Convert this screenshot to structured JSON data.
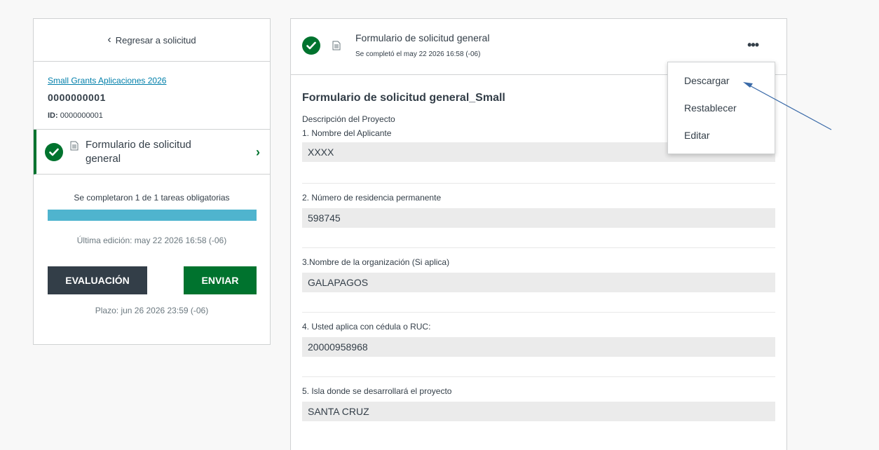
{
  "sidebar": {
    "back_label": "Regresar a solicitud",
    "program_link": "Small Grants Aplicaciones 2026",
    "application_number": "0000000001",
    "id_label": "ID:",
    "id_value": "0000000001",
    "task_label": "Formulario de solicitud general",
    "progress_text": "Se completaron 1 de 1 tareas obligatorias",
    "progress_fraction": 1.0,
    "last_edit": "Última edición: may 22 2026 16:58 (-06)",
    "eval_button": "EVALUACIÓN",
    "send_button": "ENVIAR",
    "deadline": "Plazo: jun 26 2026 23:59 (-06)"
  },
  "header": {
    "form_title": "Formulario de solicitud general",
    "completed_text": "Se completó el may 22 2026 16:58 (-06)",
    "more_label": "•••"
  },
  "form": {
    "heading": "Formulario de solicitud general_Small",
    "section": "Descripción del Proyecto",
    "fields": [
      {
        "question": "1. Nombre del Aplicante",
        "answer": "XXXX"
      },
      {
        "question": "2. Número de residencia permanente",
        "answer": "598745"
      },
      {
        "question": "3.Nombre de la organización (Si aplica)",
        "answer": "GALAPAGOS"
      },
      {
        "question": "4. Usted aplica con cédula o RUC:",
        "answer": "20000958968"
      },
      {
        "question": "5. Isla donde se desarrollará el proyecto",
        "answer": "SANTA CRUZ"
      }
    ]
  },
  "menu": {
    "items": [
      "Descargar",
      "Restablecer",
      "Editar"
    ]
  },
  "colors": {
    "success_green": "#00732e",
    "dark_button": "#333e48",
    "progress_blue": "#4fb4ce",
    "link_blue": "#007faa",
    "annotation_arrow": "#3a6aa8"
  },
  "icons": [
    "chevron-left-icon",
    "check-icon",
    "document-icon",
    "chevron-right-icon",
    "more-icon",
    "annotation-arrow-icon"
  ]
}
